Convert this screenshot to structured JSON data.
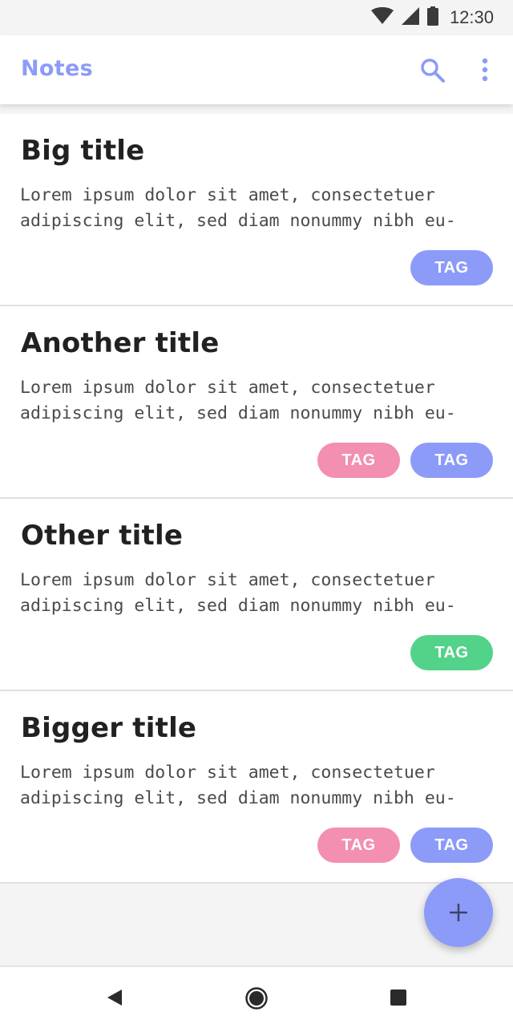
{
  "status_bar": {
    "time": "12:30",
    "icons": [
      "wifi-icon",
      "signal-icon",
      "battery-icon"
    ]
  },
  "app_bar": {
    "title": "Notes",
    "actions": [
      "search-icon",
      "more-vert-icon"
    ]
  },
  "notes": [
    {
      "title": "Big title",
      "body": "Lorem ipsum dolor sit amet, consectetuer\nadipiscing elit, sed diam nonummy nibh eu-",
      "tags": [
        {
          "label": "TAG",
          "color": "#8c9bf8"
        }
      ]
    },
    {
      "title": "Another title",
      "body": "Lorem ipsum dolor sit amet, consectetuer\nadipiscing elit, sed diam nonummy nibh eu-",
      "tags": [
        {
          "label": "TAG",
          "color": "#f38fb0"
        },
        {
          "label": "TAG",
          "color": "#8c9bf8"
        }
      ]
    },
    {
      "title": "Other title",
      "body": "Lorem ipsum dolor sit amet, consectetuer\nadipiscing elit, sed diam nonummy nibh eu-",
      "tags": [
        {
          "label": "TAG",
          "color": "#52d389"
        }
      ]
    },
    {
      "title": "Bigger title",
      "body": "Lorem ipsum dolor sit amet, consectetuer\nadipiscing elit, sed diam nonummy nibh eu-",
      "tags": [
        {
          "label": "TAG",
          "color": "#f38fb0"
        },
        {
          "label": "TAG",
          "color": "#8c9bf8"
        }
      ]
    }
  ],
  "fab": {
    "icon": "plus-icon",
    "color": "#8c9bf8"
  },
  "nav_bar": {
    "icons": [
      "back-icon",
      "home-icon",
      "recents-icon"
    ]
  },
  "colors": {
    "accent": "#8c9bf8",
    "pink": "#f38fb0",
    "green": "#52d389",
    "text": "#212121"
  }
}
